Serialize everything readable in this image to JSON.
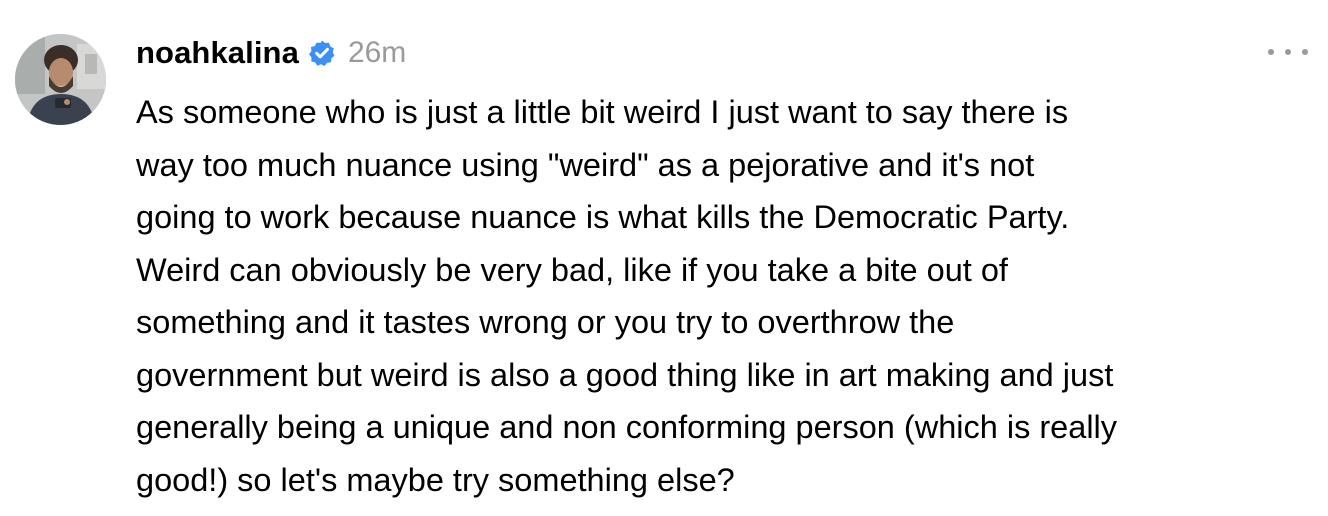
{
  "post": {
    "author": {
      "username": "noahkalina",
      "verified": true,
      "verified_badge_icon": "verified-badge-icon",
      "verified_color": "#3b8ff5",
      "avatar_icon": "avatar-photo"
    },
    "timestamp": "26m",
    "more_options_icon": "more-horizontal-icon",
    "body_lines": [
      "As someone who is just a little bit weird I just want to say there is",
      "way too much nuance using \"weird\" as a pejorative and it's not",
      "going to work because nuance is what kills the Democratic Party.",
      "Weird can obviously be very bad, like if you take a bite out of",
      "something and it tastes wrong or you try to overthrow the",
      "government but weird is also a good thing like in art making and just",
      "generally being a unique and non conforming person (which is really",
      "good!) so let's maybe try something else?"
    ]
  }
}
